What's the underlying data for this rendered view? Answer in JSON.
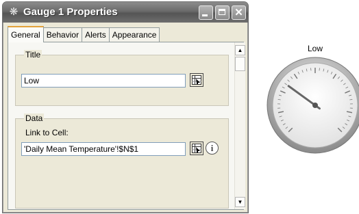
{
  "window": {
    "title": "Gauge 1 Properties",
    "icon": "gauge-icon"
  },
  "tabs": [
    {
      "label": "General",
      "active": true
    },
    {
      "label": "Behavior",
      "active": false
    },
    {
      "label": "Alerts",
      "active": false
    },
    {
      "label": "Appearance",
      "active": false
    }
  ],
  "title_group": {
    "legend": "Title",
    "value": "Low"
  },
  "data_group": {
    "legend": "Data",
    "link_label": "Link to Cell:",
    "link_value": "'Daily Mean Temperature'!$N$1"
  },
  "gauge": {
    "label": "Low",
    "needle_fraction": 0.3
  },
  "colors": {
    "accent_tab": "#e3a23a",
    "titlebar": "#6a6a6a"
  }
}
